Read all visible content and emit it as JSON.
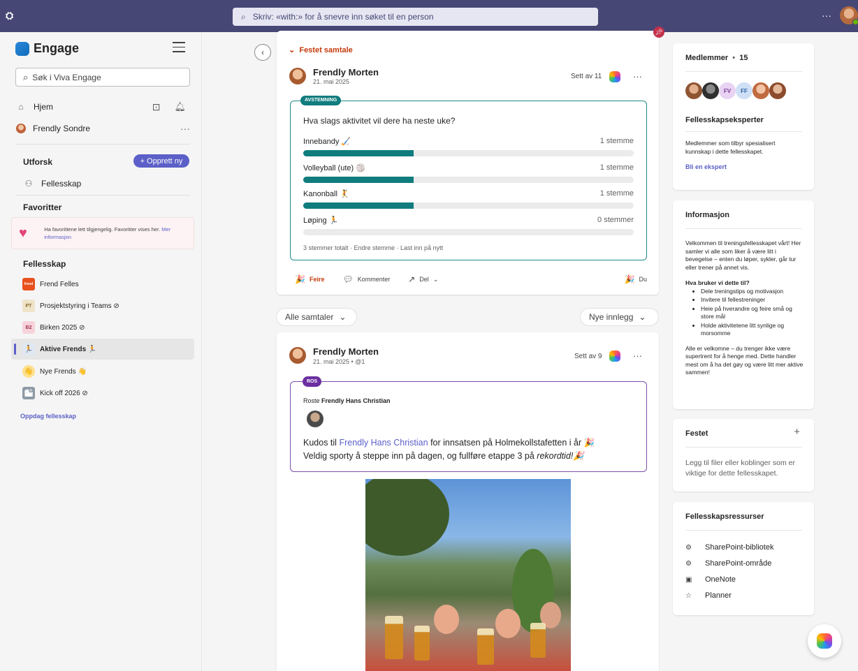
{
  "colors": {
    "topbar": "#464775",
    "accent": "#5b5fc7",
    "poll": "#107c7d",
    "praise": "#6a2fa0",
    "pinned": "#c4390a"
  },
  "topbar": {
    "app_icon": "teams-icon",
    "search_placeholder": "Skriv: «with:» for å snevre inn søket til en person",
    "more": "···"
  },
  "sidebar": {
    "brand": "Engage",
    "search_placeholder": "Søk i Viva Engage",
    "home": "Hjem",
    "user": "Frendly Sondre",
    "user_more": "···",
    "explore_title": "Utforsk",
    "create_btn": "+  Opprett ny",
    "communities_link": "Fellesskap",
    "favorites_title": "Favoritter",
    "favorites_text": "Ha favorittene lett tilgjengelig. Favoritter vises her.",
    "favorites_link": "Mer informasjon",
    "communities_title": "Fellesskap",
    "communities": [
      {
        "abbr": "frend",
        "name": "Frend Felles"
      },
      {
        "abbr": "PT",
        "name": "Prosjektstyring i Teams ⊘"
      },
      {
        "abbr": "B2",
        "name": "Birken 2025 ⊘"
      },
      {
        "abbr": "🏃",
        "name": "Aktive Frends 🏃"
      },
      {
        "abbr": "👋",
        "name": "Nye Frends 👋"
      },
      {
        "abbr": "🏙",
        "name": "Kick off 2026 ⊘"
      }
    ],
    "discover": "Oppdag fellesskap"
  },
  "pinned_post": {
    "label": "Festet samtale",
    "author": "Frendly Morten",
    "date": "21. mai 2025",
    "seen": "Sett av 11",
    "poll": {
      "tag": "AVSTEMNING",
      "question": "Hva slags aktivitet vil dere ha neste uke?",
      "options": [
        {
          "label": "Innebandy 🏑",
          "count": "1 stemme",
          "share": 0.333
        },
        {
          "label": "Volleyball (ute) 🏐",
          "count": "1 stemme",
          "share": 0.333
        },
        {
          "label": "Kanonball 🤾",
          "count": "1 stemme",
          "share": 0.333
        },
        {
          "label": "Løping 🏃",
          "count": "0 stemmer",
          "share": 0
        }
      ],
      "footer": "3 stemmer totalt · Endre stemme · Last inn på nytt"
    },
    "actions": {
      "celebrate": "Feire",
      "comment": "Kommenter",
      "share": "Del",
      "reacted": "Du"
    }
  },
  "filters": {
    "left": "Alle samtaler",
    "right": "Nye innlegg"
  },
  "post2": {
    "author": "Frendly Morten",
    "date": "21. mai 2025  •  @1",
    "seen": "Sett av 9",
    "tag": "ROS",
    "praised_prefix": "Roste",
    "praised_name": "Frendly Hans Christian",
    "line1_a": "Kudos til",
    "line1_link": "Frendly Hans Christian",
    "line1_b": "for innsatsen på Holmekollstafetten i år 🎉",
    "line2_a": "Veldig sporty å steppe inn på dagen, og fullføre etappe 3 på",
    "line2_em": "rekordtid!🎉"
  },
  "members": {
    "title": "Medlemmer",
    "count": "15",
    "avatars": [
      "",
      "",
      "FV",
      "FF",
      "",
      ""
    ],
    "experts_title": "Fellesskapseksperter",
    "experts_text": "Medlemmer som tilbyr spesialisert kunnskap i dette fellesskapet.",
    "experts_link": "Bli en ekspert"
  },
  "info": {
    "title": "Informasjon",
    "intro": "Velkommen til treningsfellesskapet vårt! Her samler vi alle som liker å være litt i bevegelse – enten du løper, sykler, går tur eller trener på annet vis.",
    "subtitle": "Hva bruker vi dette til?",
    "bullets": [
      "Dele treningstips og motivasjon",
      "Invitere til fellestreninger",
      "Heie på hverandre og feire små og store mål",
      "Holde aktivitetene litt synlige og morsomme"
    ],
    "outro": "Alle er velkomne – du trenger ikke være supertrent for å henge med. Dette handler mest om å ha det gøy og være litt mer aktive sammen!"
  },
  "pinned_box": {
    "title": "Festet",
    "text": "Legg til filer eller koblinger som er viktige for dette fellesskapet."
  },
  "resources": {
    "title": "Fellesskapsressurser",
    "items": [
      "SharePoint-bibliotek",
      "SharePoint-område",
      "OneNote",
      "Planner"
    ]
  }
}
